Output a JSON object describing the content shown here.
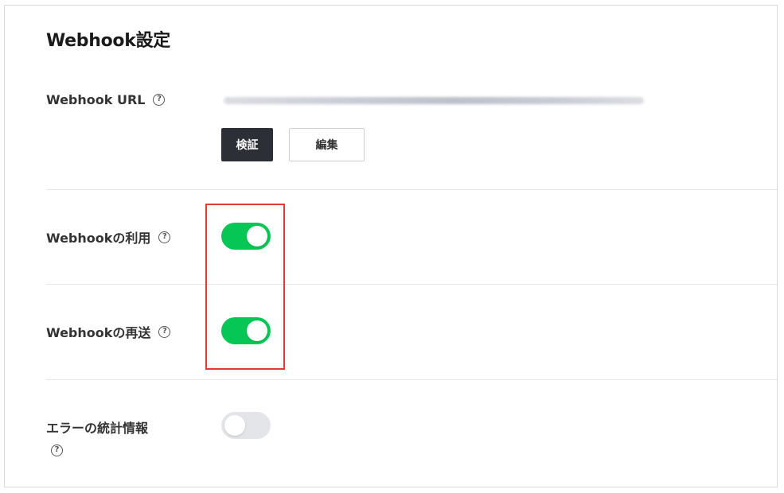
{
  "panel": {
    "title": "Webhook設定"
  },
  "webhook_url": {
    "label": "Webhook URL",
    "verify_label": "検証",
    "edit_label": "編集"
  },
  "use_webhook": {
    "label": "Webhookの利用",
    "enabled": true
  },
  "redelivery": {
    "label": "Webhookの再送",
    "enabled": true
  },
  "error_stats": {
    "label": "エラーの統計情報",
    "enabled": false
  },
  "help_icon": {
    "glyph": "?"
  },
  "colors": {
    "toggle_on": "#06c755",
    "toggle_off": "#e4e5e8",
    "primary_button": "#2c2f36",
    "highlight": "#e53935"
  }
}
